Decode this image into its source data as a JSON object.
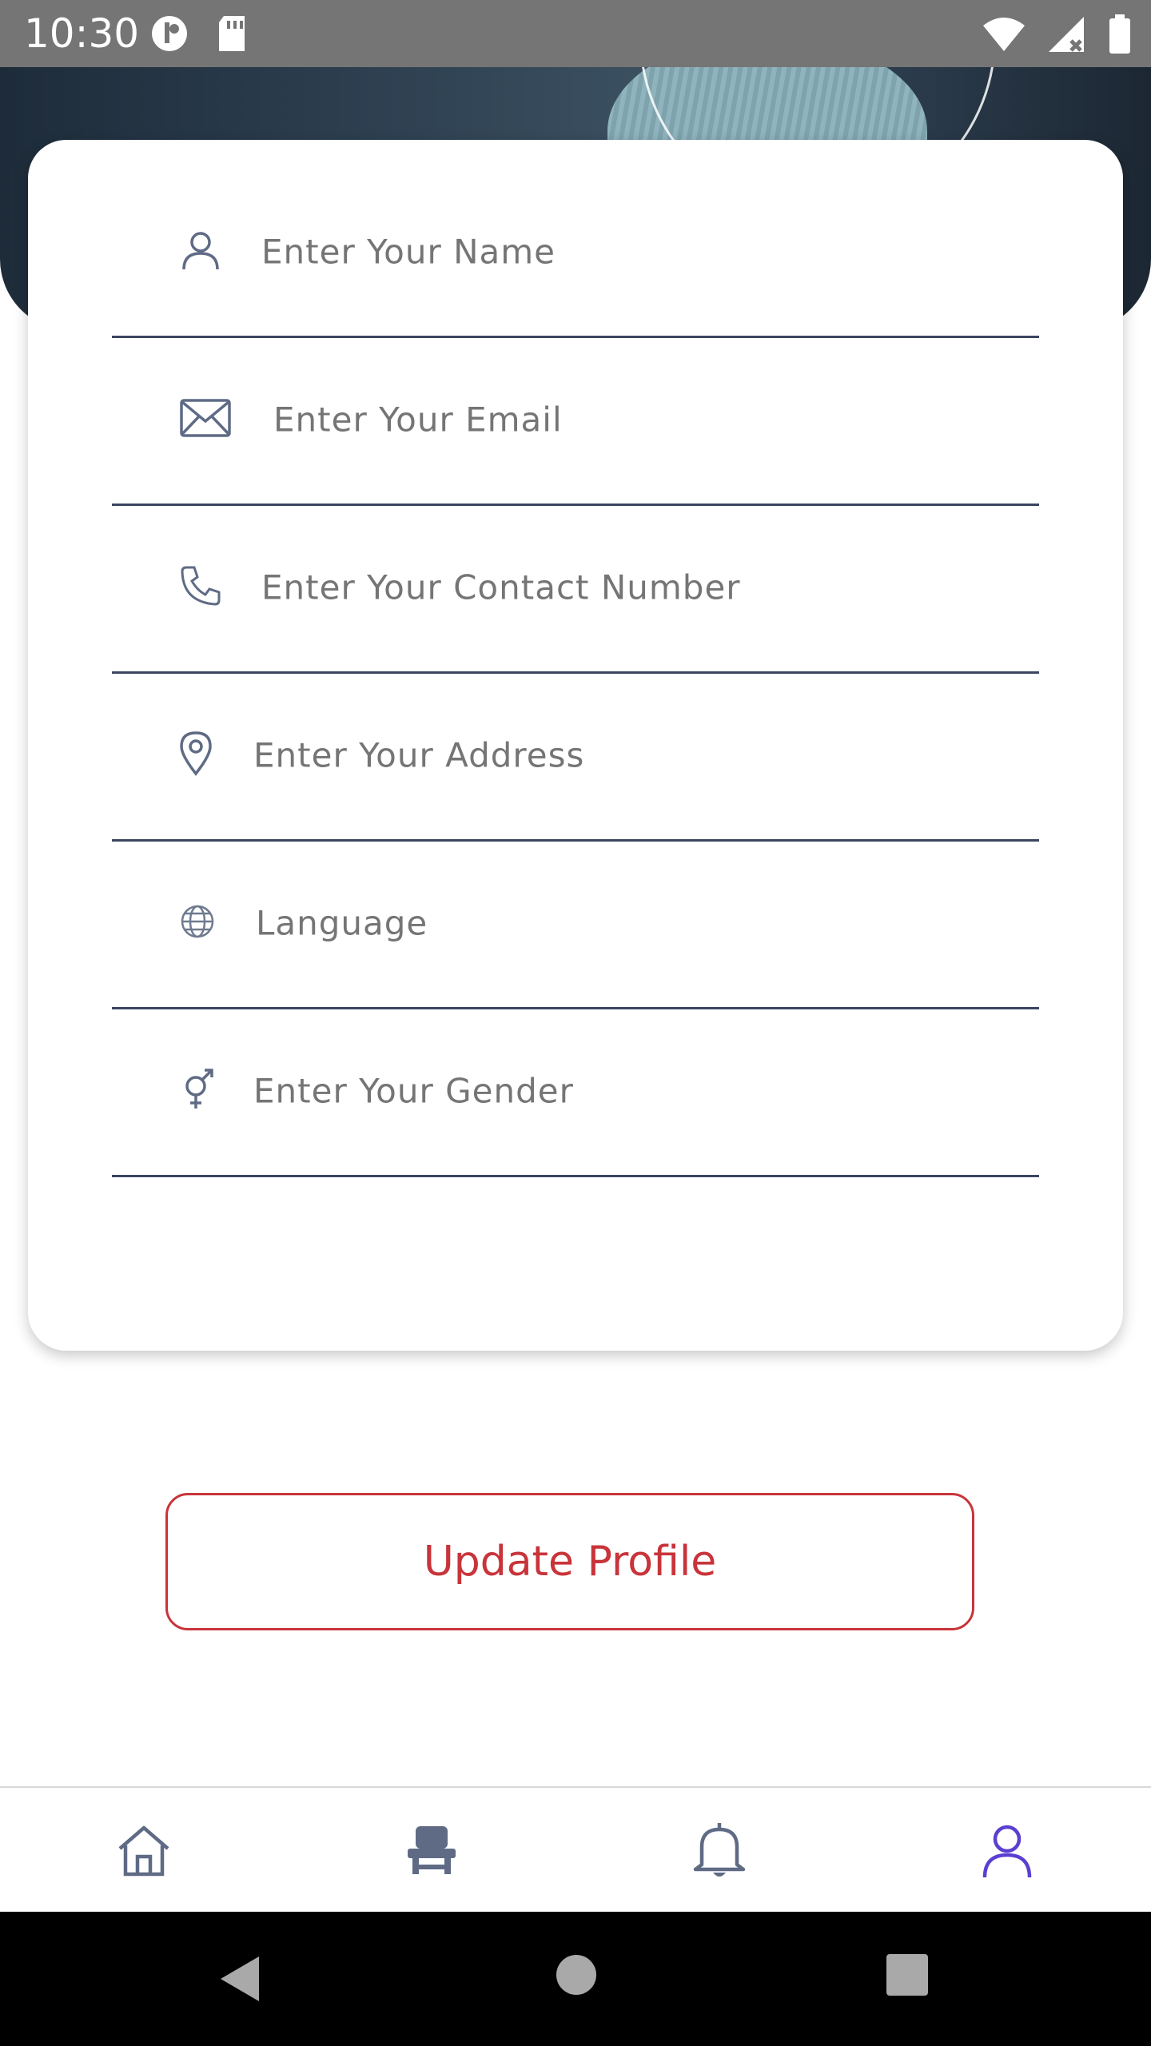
{
  "status_bar": {
    "time": "10:30"
  },
  "form": {
    "fields": [
      {
        "name": "name",
        "placeholder": "Enter Your Name",
        "icon": "person-icon"
      },
      {
        "name": "email",
        "placeholder": "Enter Your Email",
        "icon": "envelope-icon"
      },
      {
        "name": "contact",
        "placeholder": "Enter Your Contact Number",
        "icon": "phone-icon"
      },
      {
        "name": "address",
        "placeholder": "Enter Your Address",
        "icon": "location-pin-icon"
      },
      {
        "name": "language",
        "placeholder": "Language",
        "icon": "globe-icon"
      },
      {
        "name": "gender",
        "placeholder": "Enter Your Gender",
        "icon": "gender-icon"
      }
    ]
  },
  "actions": {
    "update_label": "Update Profile"
  },
  "bottom_nav": {
    "items": [
      {
        "id": "home",
        "icon": "home-icon",
        "active": false
      },
      {
        "id": "seat",
        "icon": "seat-icon",
        "active": false
      },
      {
        "id": "notifications",
        "icon": "bell-icon",
        "active": false
      },
      {
        "id": "profile",
        "icon": "profile-icon",
        "active": true
      }
    ],
    "active_color": "#5b3fd1",
    "inactive_color": "#5f6b85"
  },
  "colors": {
    "accent_red": "#c8343a",
    "field_line": "#3a4660",
    "placeholder": "#9a9a9a",
    "status_bar": "#757575"
  }
}
